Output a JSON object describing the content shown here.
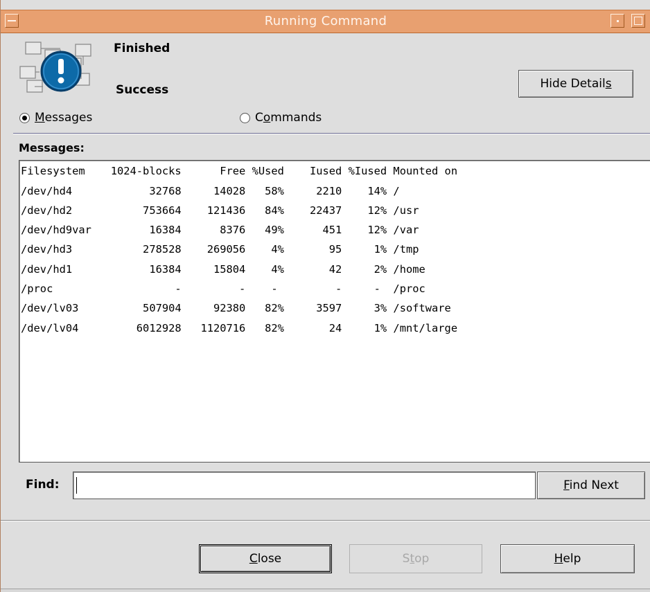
{
  "window": {
    "title": "Running Command"
  },
  "status": {
    "title": "Finished",
    "subtitle": "Success",
    "icon": "info-exclamation-icon"
  },
  "hide_details": {
    "label_pre": "Hide Detail",
    "mnemonic": "s",
    "label_post": ""
  },
  "view": {
    "messages": {
      "mnemonic": "M",
      "rest": "essages",
      "selected": true
    },
    "commands": {
      "pre": "C",
      "mnemonic": "o",
      "rest": "mmands",
      "selected": false
    }
  },
  "messages": {
    "label": "Messages:",
    "lines": [
      "Filesystem    1024-blocks      Free %Used    Iused %Iused Mounted on",
      "/dev/hd4            32768     14028   58%     2210    14% /",
      "/dev/hd2           753664    121436   84%    22437    12% /usr",
      "/dev/hd9var         16384      8376   49%      451    12% /var",
      "/dev/hd3           278528    269056    4%       95     1% /tmp",
      "/dev/hd1            16384     15804    4%       42     2% /home",
      "/proc                   -         -    -         -     -  /proc",
      "/dev/lv03          507904     92380   82%     3597     3% /software",
      "/dev/lv04         6012928   1120716   82%       24     1% /mnt/large"
    ]
  },
  "find": {
    "label": "Find:",
    "value": "",
    "button": {
      "mnemonic": "F",
      "rest": "ind Next"
    }
  },
  "buttons": {
    "close": {
      "mnemonic": "C",
      "rest": "lose"
    },
    "stop": {
      "pre": "S",
      "mnemonic": "t",
      "rest": "op"
    },
    "help": {
      "mnemonic": "H",
      "rest": "elp"
    }
  }
}
